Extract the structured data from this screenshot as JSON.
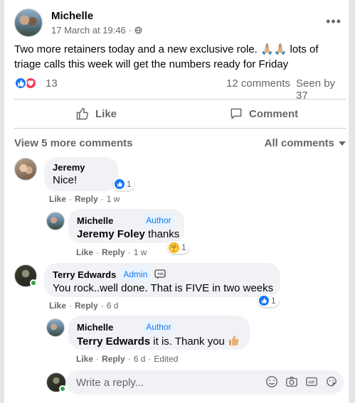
{
  "post": {
    "author": "Michelle",
    "timestamp": "17 March at 19:46",
    "separator": "·",
    "privacy_icon": "globe-icon",
    "text_part1": "Two more retainers today and a new exclusive role. ",
    "text_emoji": "🙏🏼🙏🏼",
    "text_part2": " lots of triage calls this week will get the numbers ready for Friday",
    "reaction_count": "13",
    "comments_count": "12 comments",
    "seen_count": "Seen by 37"
  },
  "actions": {
    "like_label": "Like",
    "comment_label": "Comment"
  },
  "comments_header": {
    "view_more": "View 5 more comments",
    "filter": "All comments"
  },
  "comments": [
    {
      "name": "Jeremy",
      "text": "Nice!",
      "like": "Like",
      "reply": "Reply",
      "time": "1 w",
      "reactions": "1"
    },
    {
      "name": "Michelle",
      "badge": "Author",
      "mention": "Jeremy Foley",
      "text": " thanks",
      "like": "Like",
      "reply": "Reply",
      "time": "1 w",
      "reactions": "1"
    },
    {
      "name": "Terry Edwards",
      "badge": "Admin",
      "text": "You rock..well done. That is FIVE in two weeks",
      "like": "Like",
      "reply": "Reply",
      "time": "6 d",
      "reactions": "1"
    },
    {
      "name": "Michelle",
      "badge": "Author",
      "mention": "Terry Edwards",
      "text": " it is. Thank you",
      "like": "Like",
      "reply": "Reply",
      "time": "6 d",
      "edited": "Edited"
    }
  ],
  "reply_box": {
    "placeholder": "Write a reply..."
  },
  "dot": "·",
  "colors": {
    "brand_blue": "#1877f2",
    "love_red": "#f33e58",
    "online_green": "#31a24c",
    "secondary_text": "#65676b"
  }
}
